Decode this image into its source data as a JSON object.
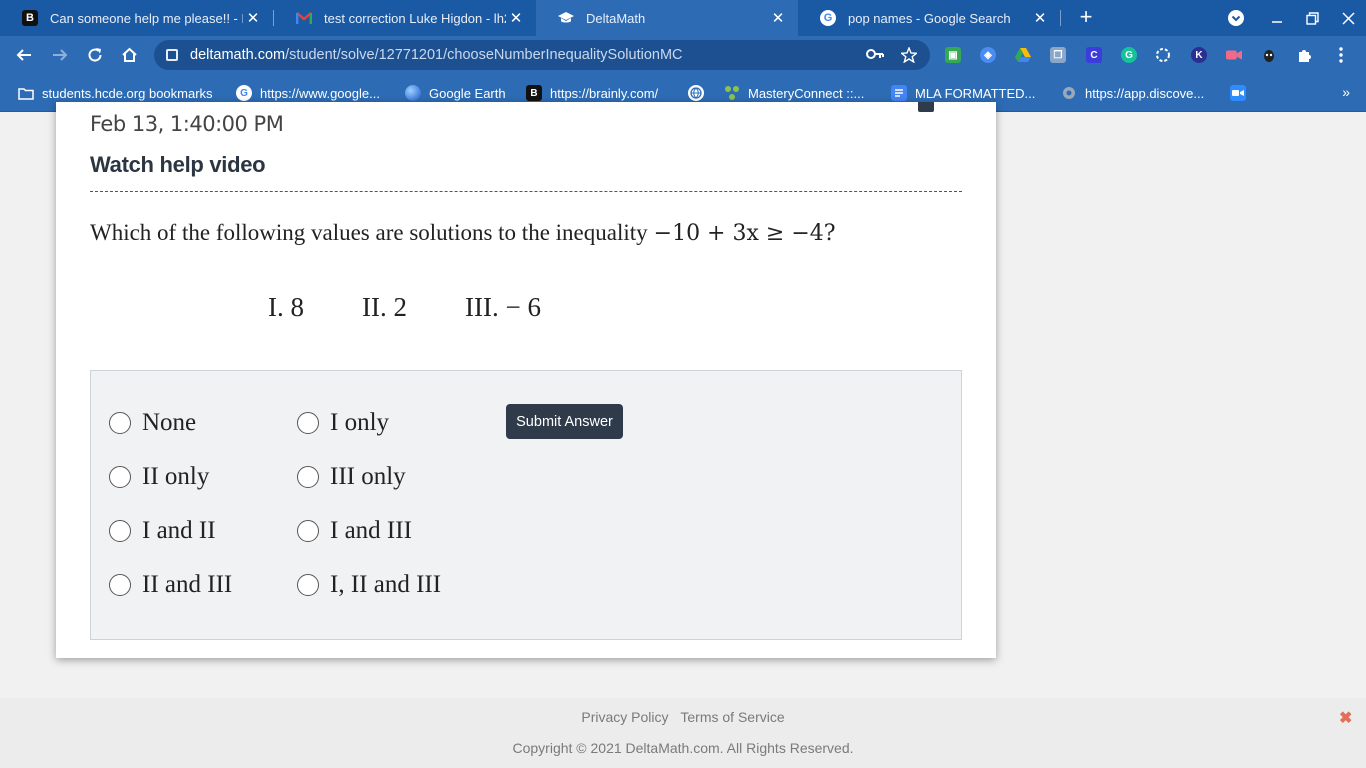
{
  "browser": {
    "tabs": [
      {
        "title": "Can someone help me please!! - Brainly.com",
        "favicon": "B",
        "active": false
      },
      {
        "title": "test correction Luke Higdon - lh2",
        "favicon": "M",
        "active": false
      },
      {
        "title": "DeltaMath",
        "favicon": "cap",
        "active": true
      },
      {
        "title": "pop names - Google Search",
        "favicon": "G",
        "active": false
      }
    ],
    "close_glyph": "✕",
    "new_tab_glyph": "+",
    "url_host": "deltamath.com",
    "url_path": "/student/solve/12771201/chooseNumberInequalitySolutionMC",
    "bookmarks": [
      {
        "label": "students.hcde.org bookmarks",
        "icon": "folder-icon"
      },
      {
        "label": "https://www.google...",
        "icon": "google-icon"
      },
      {
        "label": "Google Earth",
        "icon": "earth-icon"
      },
      {
        "label": "https://brainly.com/",
        "icon": "brainly-icon"
      },
      {
        "label": "",
        "icon": "globe-icon"
      },
      {
        "label": "MasteryConnect ::...",
        "icon": "masteryconnect-icon"
      },
      {
        "label": "MLA FORMATTED...",
        "icon": "docs-icon"
      },
      {
        "label": "https://app.discove...",
        "icon": "discovery-icon"
      },
      {
        "label": "",
        "icon": "zoom-icon"
      }
    ],
    "bookmarks_overflow": "»",
    "colors": {
      "tabstrip": "#1a5aa5",
      "toolbar": "#2d6cb5"
    }
  },
  "page": {
    "datetime": "Feb 13, 1:40:00 PM",
    "help_link": "Watch help video",
    "question_text": "Which of the following values are solutions to the inequality",
    "question_math": "−10 + 3x ≥ −4?",
    "values": [
      "I. 8",
      "II. 2",
      "III. − 6"
    ],
    "options": [
      [
        "None",
        "I only"
      ],
      [
        "II only",
        "III only"
      ],
      [
        "I and II",
        "I and III"
      ],
      [
        "II and III",
        "I, II and III"
      ]
    ],
    "submit_label": "Submit Answer"
  },
  "footer": {
    "privacy": "Privacy Policy",
    "terms": "Terms of Service",
    "copyright": "Copyright © 2021 DeltaMath.com. All Rights Reserved.",
    "close_glyph": "✖"
  }
}
